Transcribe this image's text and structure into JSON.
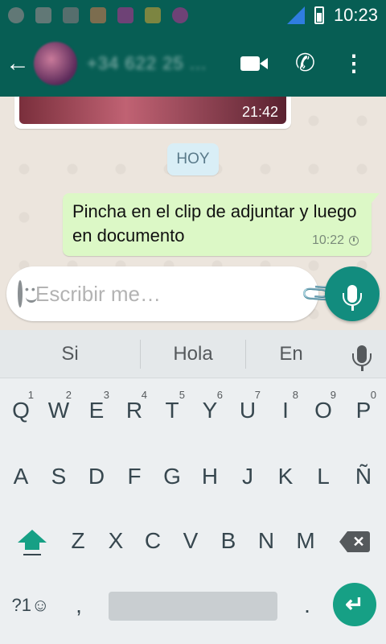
{
  "status_bar": {
    "time": "10:23"
  },
  "header": {
    "back_glyph": "←",
    "contact_name": "+34 622 25 ...",
    "phone_glyph": "✆",
    "menu_glyph": "⋮"
  },
  "chat": {
    "image_message_time": "21:42",
    "day_chip": "HOY",
    "outgoing_message": {
      "text": "Pincha en el clip de adjuntar y luego en documento",
      "time": "10:22"
    }
  },
  "composer": {
    "placeholder": "Escribir me…",
    "clip_glyph": "📎"
  },
  "keyboard": {
    "suggestions": [
      "Si",
      "Hola",
      "En"
    ],
    "row1": [
      {
        "label": "Q",
        "num": "1"
      },
      {
        "label": "W",
        "num": "2"
      },
      {
        "label": "E",
        "num": "3"
      },
      {
        "label": "R",
        "num": "4"
      },
      {
        "label": "T",
        "num": "5"
      },
      {
        "label": "Y",
        "num": "6"
      },
      {
        "label": "U",
        "num": "7"
      },
      {
        "label": "I",
        "num": "8"
      },
      {
        "label": "O",
        "num": "9"
      },
      {
        "label": "P",
        "num": "0"
      }
    ],
    "row2": [
      "A",
      "S",
      "D",
      "F",
      "G",
      "H",
      "J",
      "K",
      "L",
      "Ñ"
    ],
    "row3": [
      "Z",
      "X",
      "C",
      "V",
      "B",
      "N",
      "M"
    ],
    "symbols_label": "?1☺",
    "comma_label": ",",
    "period_label": ".",
    "backspace_glyph": "✕",
    "enter_glyph": "↵"
  },
  "colors": {
    "header": "#075e54",
    "accent": "#128c7e",
    "outgoing_bubble": "#dcf8c6",
    "keyboard_accent": "#16a085"
  }
}
